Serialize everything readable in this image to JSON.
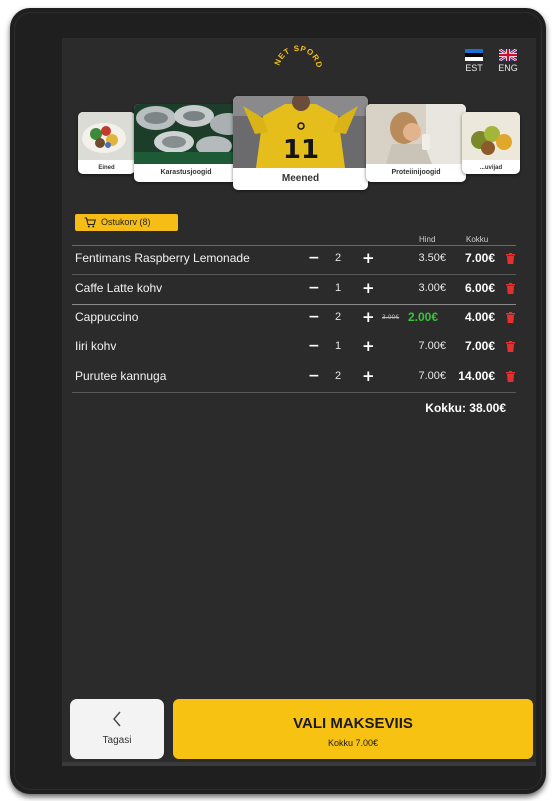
{
  "brand": {
    "logo_text": "NET SPORDIHALL",
    "logo_color": "#f6bd16"
  },
  "languages": [
    {
      "code": "EST",
      "icon": "estonia-flag-icon"
    },
    {
      "code": "ENG",
      "icon": "uk-flag-icon"
    }
  ],
  "categories": [
    {
      "label": "Eined",
      "icon": "salad-photo",
      "selected": false
    },
    {
      "label": "Karastusjoogid",
      "icon": "cans-photo",
      "selected": false
    },
    {
      "label": "Meened",
      "icon": "jersey-photo",
      "selected": true
    },
    {
      "label": "Proteiinijoogid",
      "icon": "woman-drinking-photo",
      "selected": false
    },
    {
      "label": "...uvijad",
      "icon": "fruit-photo",
      "selected": false
    }
  ],
  "cart": {
    "button_label": "Ostukorv (8)",
    "col_price": "Hind",
    "col_total": "Kokku",
    "items": [
      {
        "name": "Fentimans Raspberry Lemonade",
        "qty": "2",
        "price": "3.50€",
        "total": "7.00€"
      },
      {
        "name": "Caffe Latte kohv",
        "qty": "1",
        "price": "3.00€",
        "total": "6.00€"
      },
      {
        "name": "Cappuccino",
        "qty": "2",
        "old_price": "3.00€",
        "new_price": "2.00€",
        "total": "4.00€"
      },
      {
        "name": "Iiri kohv",
        "qty": "1",
        "price": "7.00€",
        "total": "7.00€"
      },
      {
        "name": "Purutee kannuga",
        "qty": "2",
        "price": "7.00€",
        "total": "14.00€"
      }
    ],
    "minus_symbol": "−",
    "plus_symbol": "+",
    "grand_total": "Kokku: 38.00€"
  },
  "footer": {
    "back_label": "Tagasi",
    "pay_label": "VALI MAKSEVIIS",
    "pay_sub": "Kokku 7.00€"
  },
  "colors": {
    "accent": "#f6bd16",
    "discount": "#3ac23a",
    "trash": "#e53030",
    "background": "#2b2b2b"
  }
}
